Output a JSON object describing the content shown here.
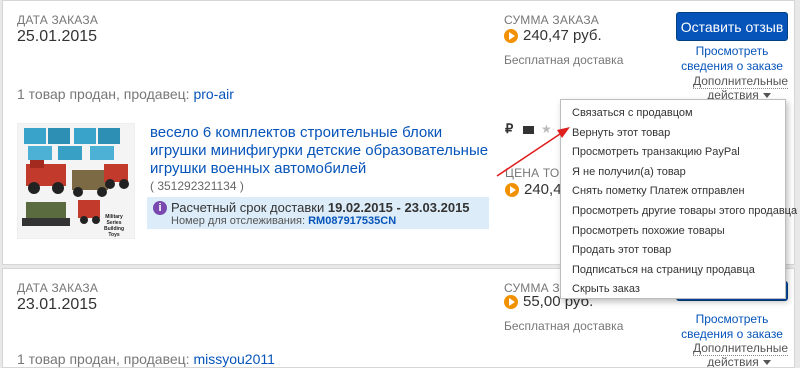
{
  "orders": [
    {
      "date_label": "ДАТА ЗАКАЗА",
      "date": "25.01.2015",
      "total_label": "СУММА ЗАКАЗА",
      "total": "240,47 руб.",
      "shipping": "Бесплатная доставка",
      "review_button": "Оставить отзыв",
      "details_link": "Просмотреть сведения о заказе",
      "more_actions": "Дополнительные действия",
      "seller_text": "1 товар продан, продавец:",
      "seller_name": "pro-air",
      "item": {
        "title": "весело 6 комплектов строительные блоки игрушки минифигурки детские образовательные игрушки военных автомобилей",
        "item_id": "( 351292321134 )",
        "delivery_label": "Расчетный срок доставки",
        "delivery_dates": "19.02.2015 - 23.03.2015",
        "tracking_label": "Номер для отслеживания:",
        "tracking_number": "RM087917535CN",
        "price_label": "ЦЕНА ТОВАР",
        "price": "240,47",
        "image_caption": "Military Series Building Toys",
        "icons_text": "₽"
      }
    },
    {
      "date_label": "ДАТА ЗАКАЗА",
      "date": "23.01.2015",
      "total_label": "СУММА ЗАКАЗА",
      "total": "55,00 руб.",
      "shipping": "Бесплатная доставка",
      "details_link": "Просмотреть сведения о заказе",
      "more_actions": "Дополнительные действия",
      "seller_text": "1 товар продан, продавец:",
      "seller_name": "missyou2011"
    }
  ],
  "menu": {
    "items": [
      "Связаться с продавцом",
      "Вернуть этот товар",
      "Просмотреть транзакцию PayPal",
      "Я не получил(а) товар",
      "Снять пометку Платеж отправлен",
      "Просмотреть другие товары этого продавца",
      "Просмотреть похожие товары",
      "Продать этот товар",
      "Подписаться на страницу продавца",
      "Скрыть заказ"
    ]
  },
  "colors": {
    "accent": "#0654ba",
    "coin": "#f29100",
    "arrow": "#e0201f",
    "info_bg": "#dcecf8"
  }
}
